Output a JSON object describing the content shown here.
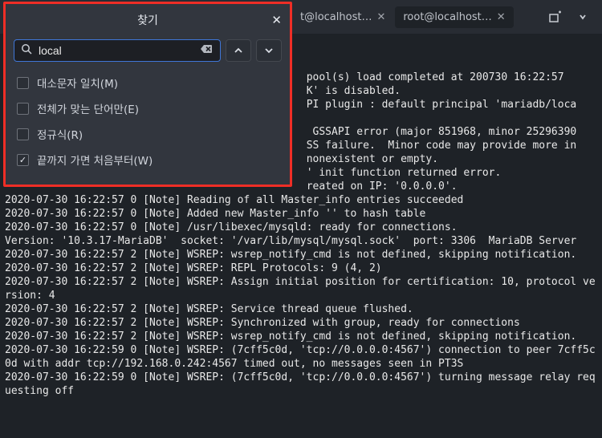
{
  "tabs": [
    {
      "label": "t@localhost…"
    },
    {
      "label": "root@localhost…"
    }
  ],
  "find": {
    "title": "찾기",
    "search_value": "local",
    "opts": {
      "case": "대소문자 일치(M)",
      "whole": "전체가 맞는 단어만(E)",
      "regex": "정규식(R)",
      "wrap": "끝까지 가면 처음부터(W)"
    }
  },
  "terminal": ") buffer pool(s) from /var/lib/mysql/ib_buff\n\n                                                pool(s) load completed at 200730 16:22:57\n                                                K' is disabled.\n                                                PI plugin : default principal 'mariadb/loca\n\n                                                 GSSAPI error (major 851968, minor 25296390\n                                                SS failure.  Minor code may provide more in\n                                                nonexistent or empty.\n                                                ' init function returned error.\n                                                reated on IP: '0.0.0.0'.\n2020-07-30 16:22:57 0 [Note] Reading of all Master_info entries succeeded\n2020-07-30 16:22:57 0 [Note] Added new Master_info '' to hash table\n2020-07-30 16:22:57 0 [Note] /usr/libexec/mysqld: ready for connections.\nVersion: '10.3.17-MariaDB'  socket: '/var/lib/mysql/mysql.sock'  port: 3306  MariaDB Server\n2020-07-30 16:22:57 2 [Note] WSREP: wsrep_notify_cmd is not defined, skipping notification.\n2020-07-30 16:22:57 2 [Note] WSREP: REPL Protocols: 9 (4, 2)\n2020-07-30 16:22:57 2 [Note] WSREP: Assign initial position for certification: 10, protocol version: 4\n2020-07-30 16:22:57 2 [Note] WSREP: Service thread queue flushed.\n2020-07-30 16:22:57 2 [Note] WSREP: Synchronized with group, ready for connections\n2020-07-30 16:22:57 2 [Note] WSREP: wsrep_notify_cmd is not defined, skipping notification.\n2020-07-30 16:22:59 0 [Note] WSREP: (7cff5c0d, 'tcp://0.0.0.0:4567') connection to peer 7cff5c0d with addr tcp://192.168.0.242:4567 timed out, no messages seen in PT3S\n2020-07-30 16:22:59 0 [Note] WSREP: (7cff5c0d, 'tcp://0.0.0.0:4567') turning message relay requesting off"
}
